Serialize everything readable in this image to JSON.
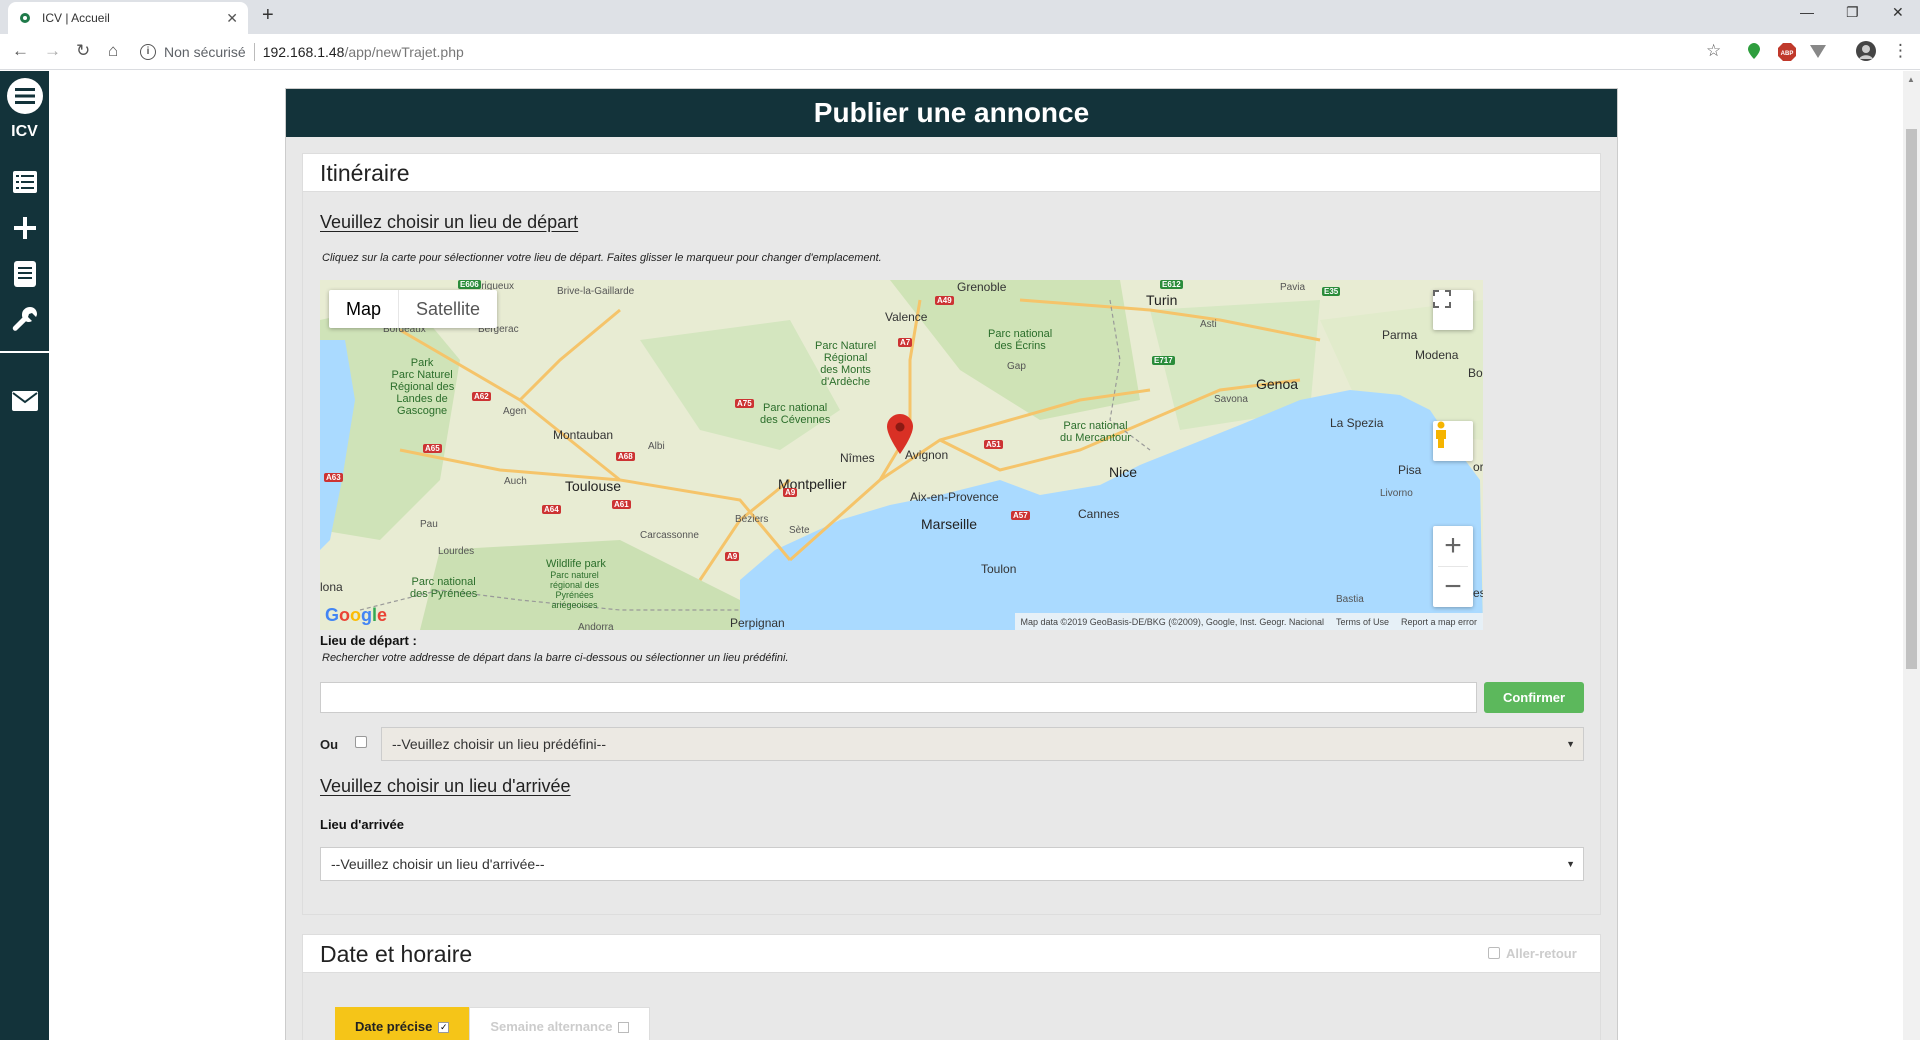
{
  "browser": {
    "tab_title": "ICV | Accueil",
    "url_security": "Non sécurisé",
    "url_host": "192.168.1.48",
    "url_path": "/app/newTrajet.php"
  },
  "sidebar": {
    "brand": "ICV",
    "items": [
      {
        "icon": "menu-icon"
      },
      {
        "icon": "list-icon"
      },
      {
        "icon": "plus-icon"
      },
      {
        "icon": "document-icon"
      },
      {
        "icon": "wrench-icon"
      },
      {
        "icon": "envelope-icon"
      }
    ]
  },
  "page": {
    "title": "Publier une annonce"
  },
  "itinerary": {
    "panel_title": "Itinéraire",
    "departure_title": "Veuillez choisir un lieu de départ",
    "departure_hint": "Cliquez sur la carte pour sélectionner votre lieu de départ. Faites glisser le marqueur pour changer d'emplacement.",
    "map": {
      "type_map": "Map",
      "type_satellite": "Satellite",
      "attribution": "Map data ©2019 GeoBasis-DE/BKG (©2009), Google, Inst. Geogr. Nacional",
      "terms": "Terms of Use",
      "report": "Report a map error",
      "google_logo": "Google",
      "places": {
        "perigueux": "Périgueux",
        "brive": "Brive-la-Gaillarde",
        "bordeaux": "Bordeaux",
        "bergerac": "Bergerac",
        "parc_landes": "Park\nParc Naturel\nRégional des\nLandes de\nGascogne",
        "agen": "Agen",
        "montauban": "Montauban",
        "albi": "Albi",
        "toulouse": "Toulouse",
        "auch": "Auch",
        "pau": "Pau",
        "lourdes": "Lourdes",
        "carcassonne": "Carcassonne",
        "beziers": "Béziers",
        "sete": "Sète",
        "perpignan": "Perpignan",
        "andorra": "Andorra",
        "lona": "lona",
        "montpellier": "Montpellier",
        "nimes": "Nîmes",
        "avignon": "Avignon",
        "aix": "Aix-en-Provence",
        "marseille": "Marseille",
        "toulon": "Toulon",
        "nice": "Nice",
        "cannes": "Cannes",
        "valence": "Valence",
        "grenoble": "Grenoble",
        "gap": "Gap",
        "turin": "Turin",
        "asti": "Asti",
        "pavia": "Pavia",
        "parma": "Parma",
        "modena": "Modena",
        "bo": "Bo",
        "genoa": "Genoa",
        "savona": "Savona",
        "la_spezia": "La Spezia",
        "pisa": "Pisa",
        "livorno": "Livorno",
        "bastia": "Bastia",
        "cevennes": "Parc national\ndes Cévennes",
        "ardeche": "Parc Naturel\nRégional\ndes Monts\nd'Ardèche",
        "ecrins": "Parc national\ndes Écrins",
        "mercantour": "Parc national\ndu Mercantour",
        "pyrenees": "Parc national\ndes Pyrénées",
        "wildlife": "Wildlife park",
        "pyr_ariegeoises": "Parc naturel\nrégional des\nPyrénées\nariégeoises",
        "edge_or": "or",
        "edge_es": "es"
      },
      "roads": {
        "e606": "E606",
        "a49": "A49",
        "a7": "A7",
        "e612": "E612",
        "e35": "E35",
        "a62": "A62",
        "a75": "A75",
        "a68": "A68",
        "a65": "A65",
        "a63": "A63",
        "a64": "A64",
        "a61": "A61",
        "a9": "A9",
        "a9b": "A9",
        "a51": "A51",
        "a57": "A57",
        "e717": "E717"
      }
    },
    "departure_label": "Lieu de départ :",
    "search_hint": "Rechercher votre addresse de départ dans la barre ci-dessous ou sélectionner un lieu prédéfini.",
    "search_value": "",
    "confirm_label": "Confirmer",
    "or_label": "Ou",
    "predefined_select": "--Veuillez choisir un lieu prédéfini--",
    "arrival_title": "Veuillez choisir un lieu d'arrivée",
    "arrival_label": "Lieu d'arrivée",
    "arrival_select": "--Veuillez choisir un lieu d'arrivée--"
  },
  "schedule": {
    "panel_title": "Date et horaire",
    "round_trip_label": "Aller-retour",
    "tab_exact": "Date précise",
    "tab_alternate": "Semaine alternance"
  },
  "colors": {
    "sidebar_bg": "#13333a",
    "confirm_green": "#5cb85c",
    "active_tab": "#f5c518",
    "marker_red": "#d93025"
  }
}
